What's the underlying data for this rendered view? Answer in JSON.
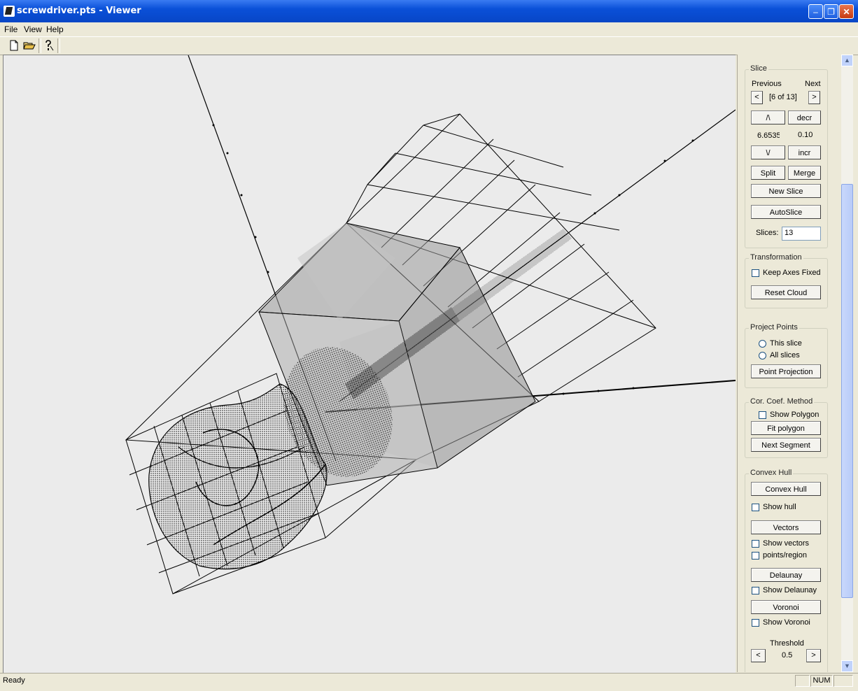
{
  "window": {
    "title": "screwdriver.pts - Viewer",
    "minimize": "–",
    "restore": "❐",
    "close": "✕"
  },
  "menu": {
    "file": "File",
    "view": "View",
    "help": "Help"
  },
  "toolbar": {
    "new_icon": "new-document-icon",
    "open_icon": "open-folder-icon",
    "help_icon": "help-icon"
  },
  "slice": {
    "group_label": "Slice",
    "previous_label": "Previous",
    "next_label": "Next",
    "prev_arrow": "<",
    "next_arrow": ">",
    "counter": "[6 of 13]",
    "up_button": "/\\",
    "decr_button": "decr",
    "position_value": "6.6535",
    "step_value": "0.10",
    "down_button": "\\/",
    "incr_button": "incr",
    "split_button": "Split",
    "merge_button": "Merge",
    "new_slice_button": "New Slice",
    "auto_slice_button": "AutoSlice",
    "slices_label": "Slices:",
    "slices_value": "13"
  },
  "transformation": {
    "group_label": "Transformation",
    "keep_axes_label": "Keep Axes Fixed",
    "keep_axes_checked": false,
    "reset_button": "Reset Cloud"
  },
  "project_points": {
    "group_label": "Project Points",
    "options": [
      "This slice",
      "All slices"
    ],
    "selected": null,
    "projection_button": "Point Projection"
  },
  "cor_coef": {
    "group_label": "Cor. Coef. Method",
    "show_polygon_label": "Show Polygon",
    "show_polygon_checked": false,
    "fit_polygon_button": "Fit polygon",
    "next_segment_button": "Next Segment"
  },
  "convex_hull": {
    "group_label": "Convex Hull",
    "hull_button": "Convex Hull",
    "show_hull_label": "Show hull",
    "vectors_button": "Vectors",
    "show_vectors_label": "Show vectors",
    "points_region_label": "points/region",
    "delaunay_button": "Delaunay",
    "show_delaunay_label": "Show Delaunay",
    "voronoi_button": "Voronoi",
    "show_voronoi_label": "Show Voronoi",
    "threshold_label": "Threshold",
    "threshold_value": "0.5",
    "threshold_dec": "<",
    "threshold_inc": ">"
  },
  "scrollbar": {
    "up": "▲",
    "down": "▼"
  },
  "status": {
    "text": "Ready",
    "num": "NUM"
  },
  "scene": {
    "line_color": "#000000",
    "cube_color": "#a9a9a9",
    "background": "#ebebeb"
  }
}
